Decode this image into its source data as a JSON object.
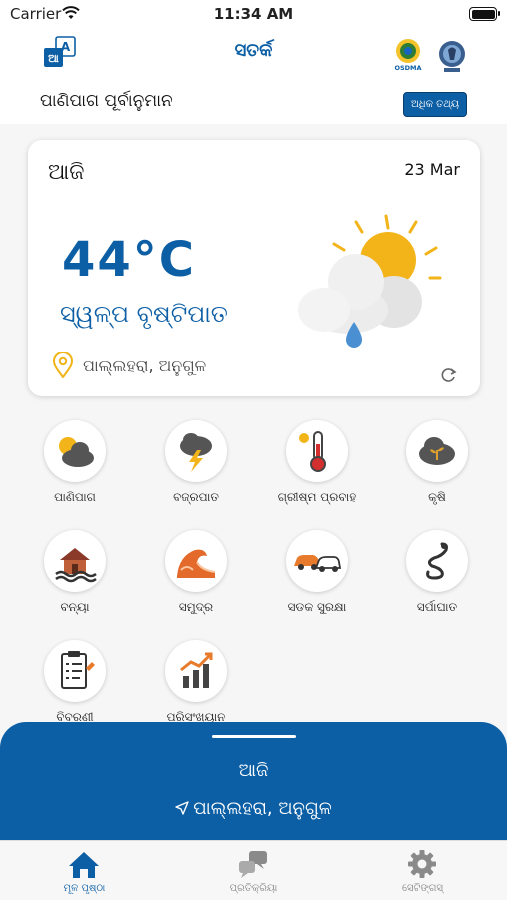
{
  "status_bar": {
    "carrier": "Carrier",
    "time": "11:34 AM"
  },
  "header": {
    "title": "ସତର୍କ",
    "translate_icon": "translate-icon",
    "logos": [
      "osdma-logo",
      "odisha-emblem"
    ],
    "osdma_logo_text": "OSDMA"
  },
  "forecast": {
    "title": "ପାଣିପାଗ ପୂର୍ବାନୁମାନ",
    "more_info_label": "ଅଧିକ ତଥ୍ୟ"
  },
  "card": {
    "day": "ଆଜି",
    "date": "23 Mar",
    "temperature": "44°C",
    "condition": "ସ୍ୱଳ୍ପ ବୃଷ୍ଟିପାତ",
    "location": "ପାଲ୍ଲହରା, ଅନୁଗୁଳ",
    "weather_icon": "partly-cloudy-rain-icon"
  },
  "tiles": [
    {
      "label": "ପାଣିପାଗ",
      "icon": "weather-cloud-icon"
    },
    {
      "label": "ବଜ୍ରପାତ",
      "icon": "lightning-icon"
    },
    {
      "label": "ଗ୍ରୀଷ୍ମ ପ୍ରବାହ",
      "icon": "thermometer-icon"
    },
    {
      "label": "କୃଷି",
      "icon": "agriculture-icon"
    },
    {
      "label": "ବନ୍ୟା",
      "icon": "flood-icon"
    },
    {
      "label": "ସମୁଦ୍ର",
      "icon": "sea-wave-icon"
    },
    {
      "label": "ସଡକ ସୁରକ୍ଷା",
      "icon": "road-safety-icon"
    },
    {
      "label": "ସର୍ପାଘାତ",
      "icon": "snake-icon"
    },
    {
      "label": "ବିବରଣୀ",
      "icon": "report-icon"
    },
    {
      "label": "ପରିସଂଖ୍ୟାନ",
      "icon": "statistics-icon"
    }
  ],
  "bottom_sheet": {
    "day": "ଆଜି",
    "location": "ପାଲ୍ଲହରା, ଅନୁଗୁଳ"
  },
  "tab_bar": [
    {
      "label": "ମୂଳ ପୃଷ୍ଠା",
      "icon": "home-icon",
      "active": true
    },
    {
      "label": "ପ୍ରତିକ୍ରିୟା",
      "icon": "feedback-icon",
      "active": false
    },
    {
      "label": "ସେଟିଙ୍ଗସ୍",
      "icon": "gear-icon",
      "active": false
    }
  ],
  "colors": {
    "primary": "#0d5fa5",
    "sun": "#f2b418",
    "active_tab": "#0d5fa5"
  }
}
